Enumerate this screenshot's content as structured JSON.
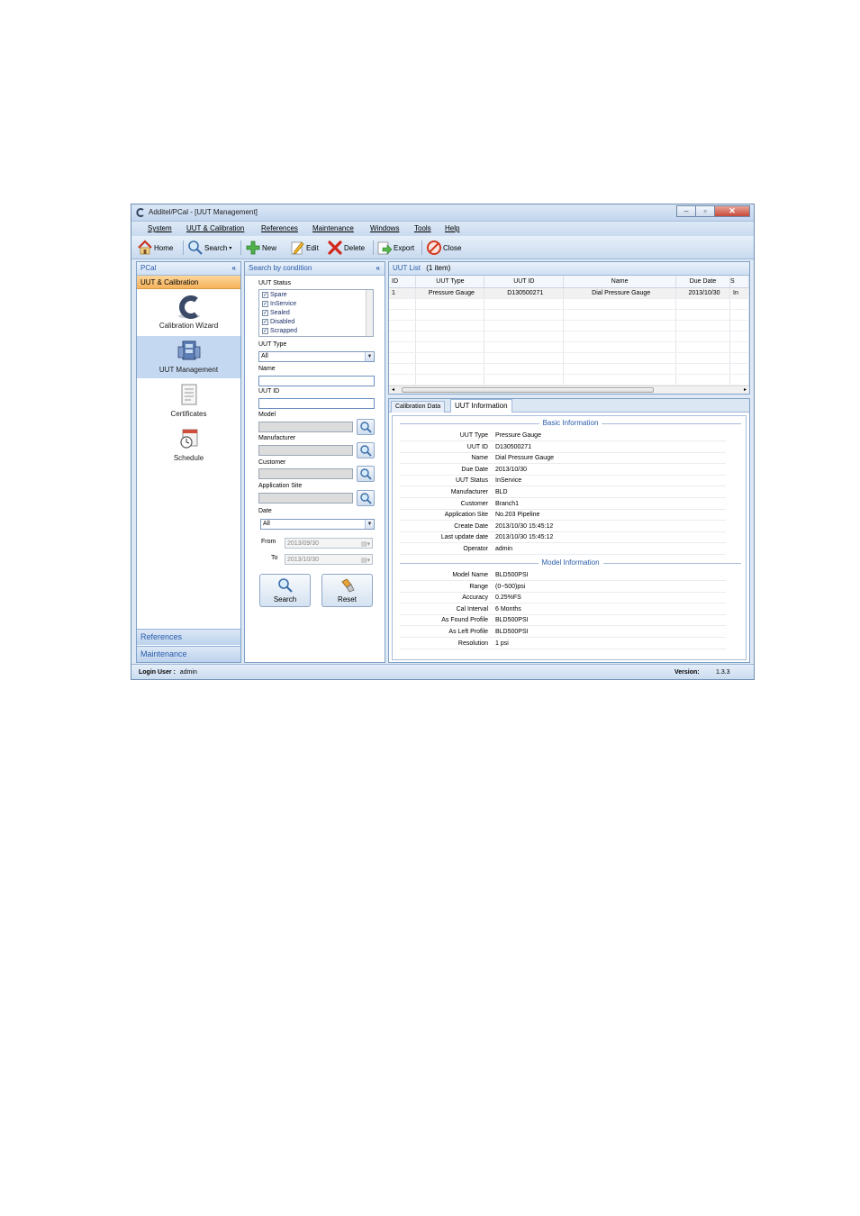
{
  "window": {
    "title": "Additel/PCal - [UUT Management]"
  },
  "menu": [
    "System",
    "UUT & Calibration",
    "References",
    "Maintenance",
    "Windows",
    "Tools",
    "Help"
  ],
  "toolbar": {
    "home": "Home",
    "search": "Search",
    "new": "New",
    "edit": "Edit",
    "delete": "Delete",
    "export": "Export",
    "close": "Close"
  },
  "nav": {
    "header": "PCal",
    "collapse": "«",
    "active_group": "UUT & Calibration",
    "tiles": [
      "Calibration Wizard",
      "UUT Management",
      "Certificates",
      "Schedule"
    ],
    "bottom": [
      "References",
      "Maintenance"
    ]
  },
  "search": {
    "header": "Search by condition",
    "collapse": "«",
    "status_label": "UUT Status",
    "statuses": [
      "Spare",
      "InService",
      "Sealed",
      "Disabled",
      "Scrapped"
    ],
    "uut_type_label": "UUT Type",
    "uut_type_value": "All",
    "name_label": "Name",
    "uut_id_label": "UUT ID",
    "model_label": "Model",
    "manufacturer_label": "Manufacturer",
    "customer_label": "Customer",
    "application_site_label": "Application Site",
    "date_label": "Date",
    "date_value": "All",
    "from_label": "From",
    "from_value": "2013/09/30",
    "to_label": "To",
    "to_value": "2013/10/30",
    "search_button": "Search",
    "reset_button": "Reset"
  },
  "list": {
    "header": "UUT List",
    "count": "(1 item)",
    "columns": [
      "ID",
      "UUT Type",
      "UUT ID",
      "Name",
      "Due Date",
      "S"
    ],
    "rows": [
      [
        "1",
        "Pressure Gauge",
        "D130500271",
        "Dial Pressure Gauge",
        "2013/10/30",
        "In"
      ]
    ]
  },
  "detail": {
    "tabs": [
      "Calibration Data",
      "UUT Information"
    ],
    "basic_title": "Basic Information",
    "basic": [
      {
        "k": "UUT Type",
        "v": "Pressure Gauge"
      },
      {
        "k": "UUT ID",
        "v": "D130500271"
      },
      {
        "k": "Name",
        "v": "Dial Pressure Gauge"
      },
      {
        "k": "Due Date",
        "v": "2013/10/30"
      },
      {
        "k": "UUT Status",
        "v": "InService"
      },
      {
        "k": "Manufacturer",
        "v": "BLD"
      },
      {
        "k": "Customer",
        "v": "Branch1"
      },
      {
        "k": "Application Site",
        "v": "No.203 Pipeline"
      },
      {
        "k": "Create Date",
        "v": "2013/10/30 15:45:12"
      },
      {
        "k": "Last update date",
        "v": "2013/10/30 15:45:12"
      },
      {
        "k": "Operator",
        "v": "admin"
      }
    ],
    "model_title": "Model Information",
    "model": [
      {
        "k": "Model Name",
        "v": "BLD500PSI"
      },
      {
        "k": "Range",
        "v": "(0~500)psi"
      },
      {
        "k": "Accuracy",
        "v": "0.25%FS"
      },
      {
        "k": "Cal Interval",
        "v": "6 Months"
      },
      {
        "k": "As Found Profile",
        "v": "BLD500PSI"
      },
      {
        "k": "As Left Profile",
        "v": "BLD500PSI"
      },
      {
        "k": "Resolution",
        "v": "1 psi"
      }
    ]
  },
  "status_bar": {
    "login_label": "Login User :",
    "login_user": "admin",
    "version_label": "Version:",
    "version": "1.3.3"
  }
}
